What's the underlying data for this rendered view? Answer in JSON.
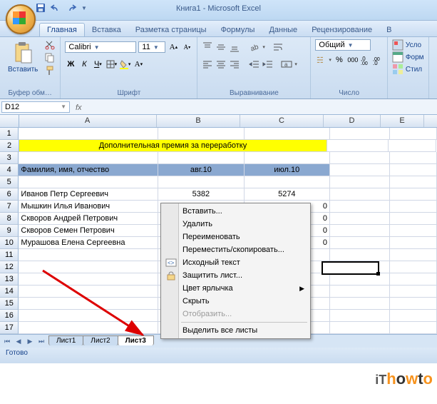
{
  "title": "Книга1 - Microsoft Excel",
  "tabs": {
    "t0": "Главная",
    "t1": "Вставка",
    "t2": "Разметка страницы",
    "t3": "Формулы",
    "t4": "Данные",
    "t5": "Рецензирование",
    "t6": "В"
  },
  "ribbon": {
    "clipboard": {
      "paste": "Вставить",
      "title": "Буфер обм…"
    },
    "font": {
      "name": "Calibri",
      "size": "11",
      "title": "Шрифт"
    },
    "align": {
      "title": "Выравнивание"
    },
    "number": {
      "format": "Общий",
      "title": "Число"
    },
    "styles": {
      "cond": "Усло",
      "format": "Форм",
      "cell": "Стил"
    }
  },
  "namebox": "D12",
  "cols": {
    "A": "A",
    "B": "B",
    "C": "C",
    "D": "D",
    "E": "E"
  },
  "colw": {
    "A": 193,
    "B": 116,
    "C": 116,
    "D": 79,
    "E": 60
  },
  "rows": {
    "r2": {
      "merged": "Дополнительная премия за переработку"
    },
    "r4": {
      "A": "Фамилия, имя, отчество",
      "B": "авг.10",
      "C": "июл.10"
    },
    "r6": {
      "A": "Иванов Петр Сергеевич",
      "B": "5382",
      "C": "5274"
    },
    "r7": {
      "A": "Мышкин Илья Иванович",
      "C": "0"
    },
    "r8": {
      "A": "Скворов Андрей Петрович",
      "C": "0"
    },
    "r9": {
      "A": "Скворов Семен Петрович",
      "C": "0"
    },
    "r10": {
      "A": "Мурашова Елена Сергеевна",
      "C": "0"
    }
  },
  "ctx": {
    "insert": "Вставить...",
    "delete": "Удалить",
    "rename": "Переименовать",
    "move": "Переместить/скопировать...",
    "code": "Исходный текст",
    "protect": "Защитить лист...",
    "color": "Цвет ярлычка",
    "hide": "Скрыть",
    "unhide": "Отобразить...",
    "selectall": "Выделить все листы"
  },
  "sheets": {
    "s1": "Лист1",
    "s2": "Лист2",
    "s3": "Лист3"
  },
  "status": "Готово",
  "watermark": {
    "it": "iT",
    "h": "h",
    "o": "o",
    "w": "w",
    "t": "t",
    "o2": "o"
  }
}
